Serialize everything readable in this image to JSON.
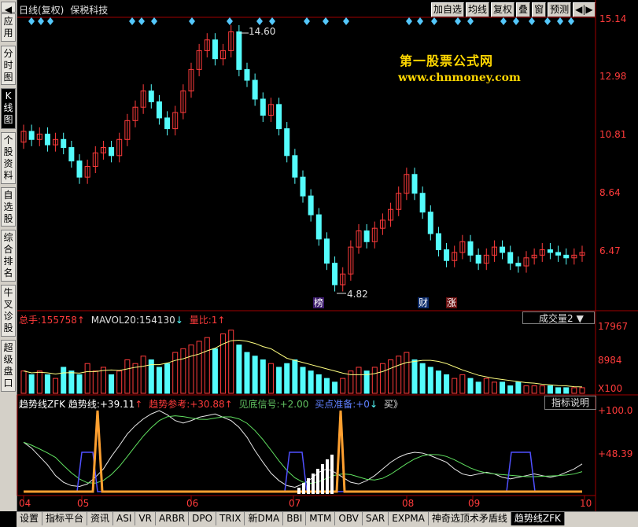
{
  "header": {
    "period": "日线(复权)",
    "stock": "保税科技"
  },
  "toolbar": {
    "b1": "加自选",
    "b2": "均线",
    "b3": "复权",
    "b4": "叠",
    "b5": "窗",
    "b6": "预测",
    "b7": "◀|▶"
  },
  "sidebar": [
    "应用",
    "分时图",
    "K线图",
    "个股资料",
    "自选股",
    "综合排名",
    "牛叉诊股",
    "超级盘口"
  ],
  "price_axis": [
    "15.14",
    "12.98",
    "10.81",
    "8.64",
    "6.47"
  ],
  "price_marks": {
    "high": "14.60",
    "low": "4.82"
  },
  "markers": {
    "bang": "榜",
    "cai": "财",
    "zhang": "涨"
  },
  "watermark": {
    "line1": "第一股票公式网",
    "line2": "www.chnmoney.com"
  },
  "volume": {
    "label1": "总手:",
    "v1": "155758",
    "label2": "MAVOL20:",
    "v2": "154130",
    "label3": "量比:",
    "v3": "1",
    "selector": "成交量2",
    "axis": [
      "17967",
      "8984",
      "X100"
    ]
  },
  "indicator": {
    "name": "趋势线ZFK",
    "l1": "趋势线:",
    "v1": "+39.11",
    "l2": "趋势参考:",
    "v2": "+30.88",
    "l3": "见底信号:",
    "v3": "+2.00",
    "l4": "买点准备:",
    "v4": "+0",
    "l5": "买》",
    "help": "指标说明",
    "axis": [
      "+100.0",
      "+48.39"
    ]
  },
  "x_axis": [
    "04",
    "05",
    "06",
    "07",
    "08",
    "09",
    "10"
  ],
  "tabs": [
    "设置",
    "指标平台",
    "资讯",
    "ASI",
    "VR",
    "ARBR",
    "DPO",
    "TRIX",
    "新DMA",
    "BBI",
    "MTM",
    "OBV",
    "SAR",
    "EXPMA",
    "神奇选顶术矛盾线",
    "趋势线ZFK"
  ],
  "colors": {
    "up": "#ff3b3b",
    "down": "#54fcfc",
    "ma": "#ffff80",
    "orange": "#ffa030",
    "blue": "#5050ff",
    "green": "#60e060",
    "white": "#ffffff"
  },
  "chart_data": {
    "type": "candlestick",
    "title": "",
    "x": [
      "04",
      "05",
      "06",
      "07",
      "08",
      "09",
      "10"
    ],
    "price_ylim": [
      4.82,
      15.14
    ],
    "candles_open_close": [
      [
        10.5,
        10.9
      ],
      [
        10.9,
        10.6
      ],
      [
        10.6,
        10.8
      ],
      [
        10.8,
        10.4
      ],
      [
        10.4,
        10.6
      ],
      [
        10.6,
        10.3
      ],
      [
        10.3,
        9.8
      ],
      [
        9.8,
        9.2
      ],
      [
        9.2,
        9.6
      ],
      [
        9.6,
        10.1
      ],
      [
        10.1,
        10.3
      ],
      [
        10.3,
        10.0
      ],
      [
        10.0,
        10.6
      ],
      [
        10.6,
        11.3
      ],
      [
        11.3,
        11.8
      ],
      [
        11.8,
        12.4
      ],
      [
        12.4,
        12.0
      ],
      [
        12.0,
        11.4
      ],
      [
        11.4,
        11.0
      ],
      [
        11.0,
        11.6
      ],
      [
        11.6,
        12.4
      ],
      [
        12.4,
        13.2
      ],
      [
        13.2,
        13.9
      ],
      [
        13.9,
        14.3
      ],
      [
        14.3,
        13.6
      ],
      [
        13.6,
        13.9
      ],
      [
        13.9,
        14.6
      ],
      [
        14.6,
        13.2
      ],
      [
        13.2,
        12.8
      ],
      [
        12.8,
        12.1
      ],
      [
        12.1,
        11.5
      ],
      [
        11.5,
        11.9
      ],
      [
        11.9,
        11.0
      ],
      [
        11.0,
        10.0
      ],
      [
        10.0,
        9.2
      ],
      [
        9.2,
        8.5
      ],
      [
        8.5,
        7.8
      ],
      [
        7.8,
        6.9
      ],
      [
        6.9,
        6.0
      ],
      [
        6.0,
        5.2
      ],
      [
        5.2,
        5.6
      ],
      [
        5.6,
        6.6
      ],
      [
        6.6,
        7.2
      ],
      [
        7.2,
        6.8
      ],
      [
        6.8,
        7.3
      ],
      [
        7.3,
        7.6
      ],
      [
        7.6,
        8.0
      ],
      [
        8.0,
        8.6
      ],
      [
        8.6,
        9.3
      ],
      [
        9.3,
        8.6
      ],
      [
        8.6,
        7.9
      ],
      [
        7.9,
        7.1
      ],
      [
        7.1,
        6.5
      ],
      [
        6.5,
        6.1
      ],
      [
        6.1,
        6.4
      ],
      [
        6.4,
        6.8
      ],
      [
        6.8,
        6.3
      ],
      [
        6.3,
        6.0
      ],
      [
        6.0,
        6.3
      ],
      [
        6.3,
        6.6
      ],
      [
        6.6,
        6.4
      ],
      [
        6.4,
        6.0
      ],
      [
        6.0,
        5.9
      ],
      [
        5.9,
        6.2
      ],
      [
        6.2,
        6.3
      ],
      [
        6.3,
        6.5
      ],
      [
        6.5,
        6.4
      ],
      [
        6.4,
        6.3
      ],
      [
        6.3,
        6.2
      ],
      [
        6.2,
        6.3
      ],
      [
        6.3,
        6.4
      ]
    ],
    "volume_ylim": [
      0,
      17967
    ],
    "indicator_ylim": [
      0,
      100
    ]
  }
}
